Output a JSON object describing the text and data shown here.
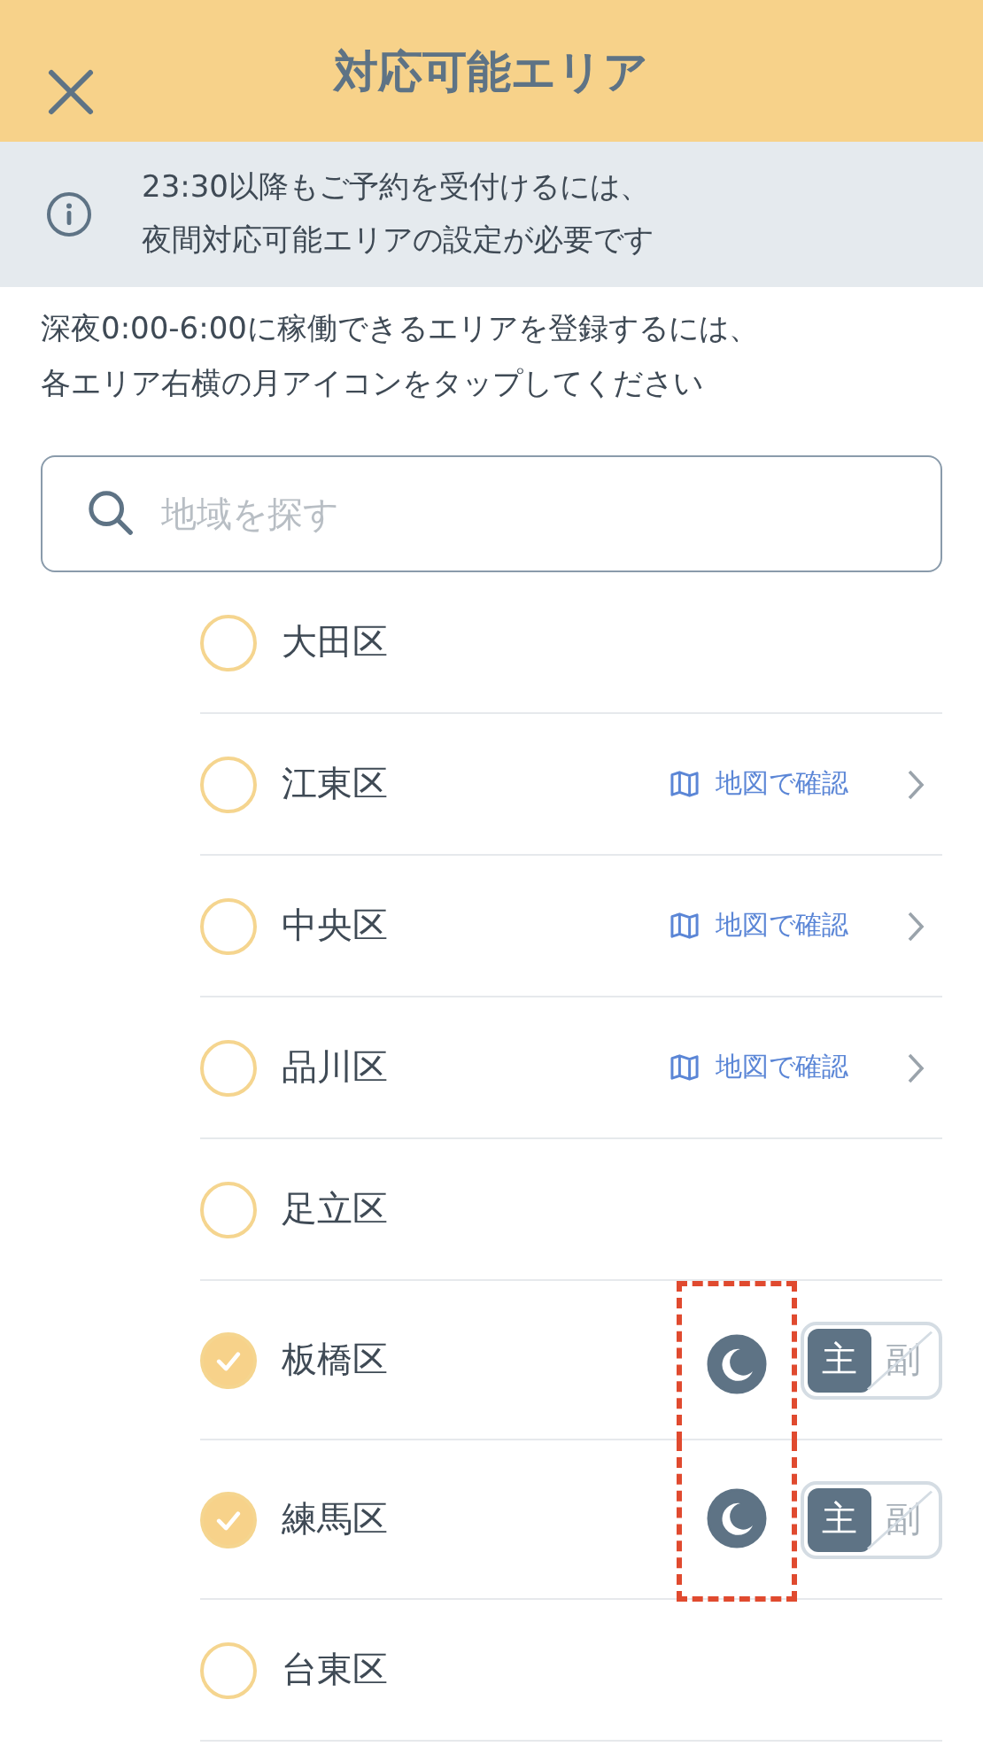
{
  "header": {
    "title": "対応可能エリア"
  },
  "notice": {
    "lines": [
      "23:30以降もご予約を受付けるには、",
      "夜間対応可能エリアの設定が必要です"
    ]
  },
  "instruction": {
    "lines": [
      "深夜0:00-6:00に稼働できるエリアを登録するには、",
      "各エリア右横の月アイコンをタップしてください"
    ]
  },
  "search": {
    "placeholder": "地域を探す"
  },
  "areas": [
    {
      "name": "大田区",
      "checked": false
    },
    {
      "name": "江東区",
      "checked": false,
      "map_link": "地図で確認"
    },
    {
      "name": "中央区",
      "checked": false,
      "map_link": "地図で確認"
    },
    {
      "name": "品川区",
      "checked": false,
      "map_link": "地図で確認"
    },
    {
      "name": "足立区",
      "checked": false
    },
    {
      "name": "板橋区",
      "checked": true,
      "night": true,
      "roles": [
        {
          "label": "主",
          "selected": true
        },
        {
          "label": "副",
          "selected": false
        }
      ]
    },
    {
      "name": "練馬区",
      "checked": true,
      "night": true,
      "roles": [
        {
          "label": "主",
          "selected": true
        },
        {
          "label": "副",
          "selected": false
        }
      ]
    },
    {
      "name": "台東区",
      "checked": false
    }
  ]
}
